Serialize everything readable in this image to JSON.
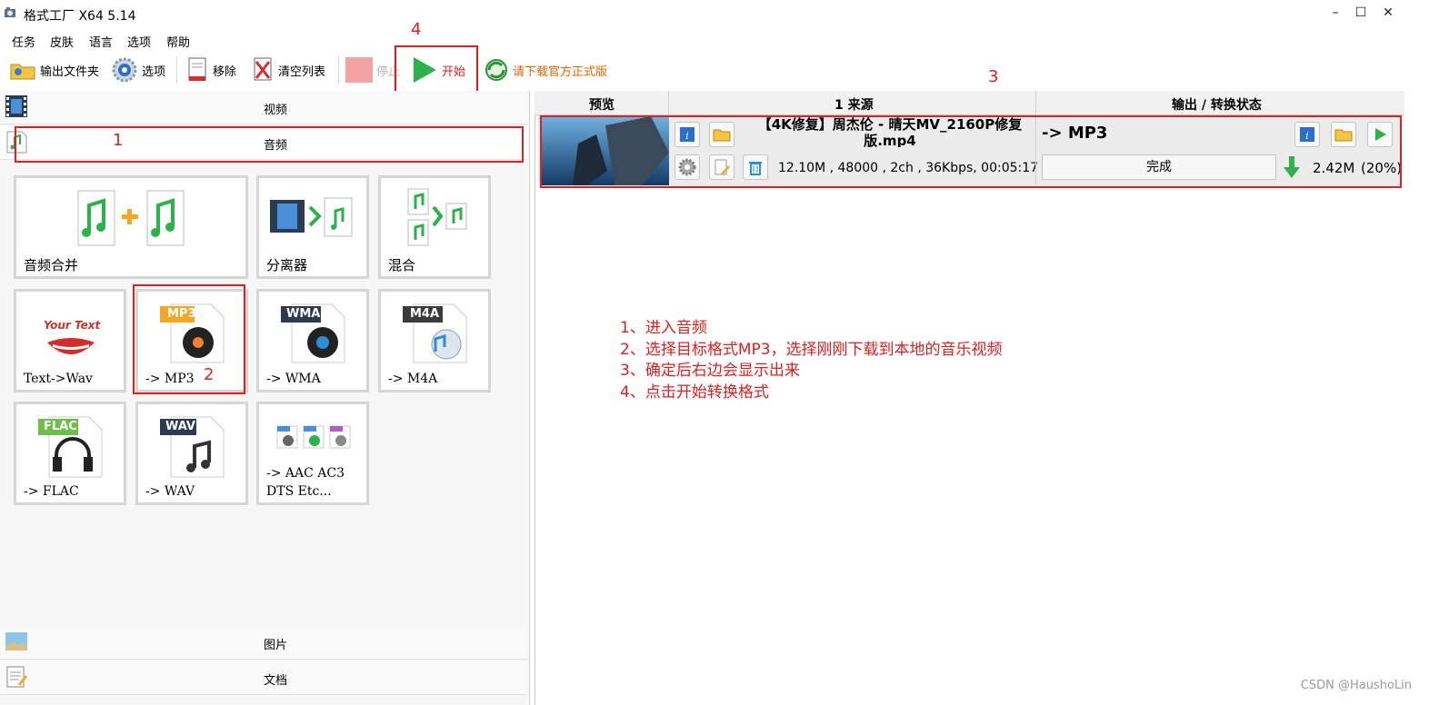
{
  "window": {
    "title": "格式工厂 X64 5.14",
    "minimize": "–",
    "maximize": "☐",
    "close": "✕"
  },
  "menu": [
    "任务",
    "皮肤",
    "语言",
    "选项",
    "帮助"
  ],
  "toolbar": {
    "output_folder": "输出文件夹",
    "options": "选项",
    "remove": "移除",
    "clear_list": "清空列表",
    "stop": "停止",
    "start": "开始",
    "download_official": "请下载官方正式版"
  },
  "categories": {
    "video": "视频",
    "audio": "音频",
    "image": "图片",
    "document": "文档"
  },
  "audio_tiles": {
    "merge": "音频合并",
    "splitter": "分离器",
    "mix": "混合",
    "text_to_wav": "Text->Wav",
    "text_art": "Your Text",
    "mp3": "-> MP3",
    "wma": "-> WMA",
    "m4a": "-> M4A",
    "flac": "-> FLAC",
    "wav": "-> WAV",
    "aac": "-> AAC AC3\nDTS Etc...",
    "badge_mp3": "MP3",
    "badge_wma": "WMA",
    "badge_m4a": "M4A",
    "badge_flac": "FLAC",
    "badge_wav": "WAV"
  },
  "table": {
    "headers": {
      "preview": "预览",
      "source": "1 来源",
      "output": "输出 / 转换状态"
    },
    "row": {
      "filename": "【4K修复】周杰伦 - 晴天MV_2160P修复版.mp4",
      "info": "12.10M , 48000 , 2ch , 36Kbps, 00:05:17",
      "target": "-> MP3",
      "status": "完成",
      "output_size": "2.42M",
      "ratio": "(20%)"
    }
  },
  "annotations": {
    "n1": "1",
    "n2": "2",
    "n3": "3",
    "n4": "4",
    "notes": [
      "1、进入音频",
      "2、选择目标格式MP3，选择刚刚下载到本地的音乐视频",
      "3、确定后右边会显示出来",
      "4、点击开始转换格式"
    ],
    "color": "#e02020"
  },
  "watermark": "CSDN @HaushoLin",
  "colors": {
    "accent_green": "#2bb34a",
    "link_orange": "#f06000",
    "annotation_red": "#e02020"
  }
}
